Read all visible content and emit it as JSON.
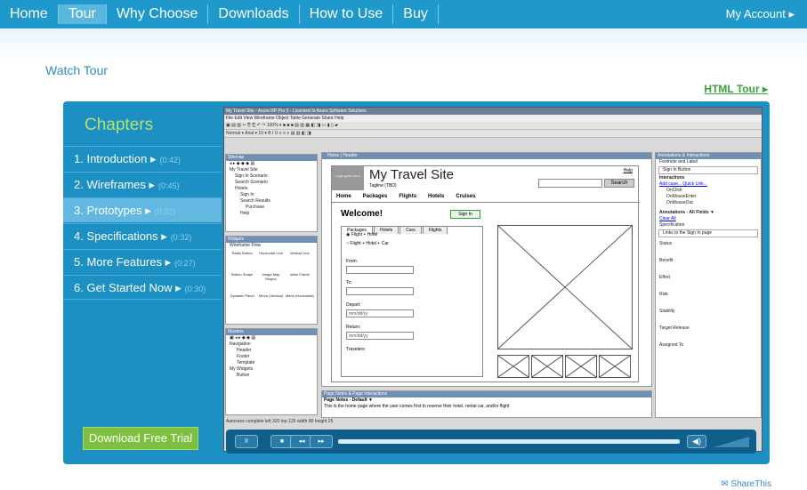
{
  "nav": {
    "items": [
      "Home",
      "Tour",
      "Why Choose",
      "Downloads",
      "How to Use",
      "Buy"
    ],
    "active": "Tour",
    "account": "My Account ▸"
  },
  "watch_tour": "Watch Tour",
  "html_tour": "HTML Tour ▸",
  "chapters": {
    "heading": "Chapters",
    "items": [
      {
        "label": "1. Introduction ▸",
        "time": "(0:42)"
      },
      {
        "label": "2. Wireframes ▸",
        "time": "(0:45)"
      },
      {
        "label": "3. Prototypes ▸",
        "time": "(0:32)"
      },
      {
        "label": "4. Specifications ▸",
        "time": "(0:32)"
      },
      {
        "label": "5. More Features ▸",
        "time": "(0:27)"
      },
      {
        "label": "6. Get Started Now ▸",
        "time": "(0:30)"
      }
    ],
    "active_index": 2
  },
  "download": "Download Free Trial",
  "app": {
    "title": "My Travel Site - Axure RP Pro 5 - Licensed to Axure Software Solutions",
    "menu": "File  Edit  View  Wireframe  Object  Table  Generate  Share  Help",
    "sitemap": {
      "header": "Sitemap",
      "items": [
        "My Travel Site",
        "Sign In Scenario",
        "Search Scenario",
        "Hotels",
        "Sign In",
        "Search Results",
        "Purchase",
        "Help"
      ]
    },
    "widgets": {
      "header": "Widgets",
      "tabs": "Wireframe  Flow",
      "items": [
        "Radio Button",
        "Horizontal Line",
        "Vertical Line",
        "Button Shape",
        "Image Map Region",
        "Inline Frame",
        "Dynamic Panel",
        "Menu (Vertical)",
        "Menu (Horizontal)"
      ]
    },
    "masters": {
      "header": "Masters",
      "items": [
        "Navigation",
        "Header",
        "Footer",
        "Template",
        "My Widgets",
        "Button"
      ]
    },
    "tabs": "Home  |  Header",
    "site": {
      "logo": "Logo goes here",
      "name": "My Travel Site",
      "tagline": "Tagline (TBD)",
      "search": "Search",
      "nav": [
        "Home",
        "Packages",
        "Flights",
        "Hotels",
        "Cruises"
      ],
      "help": "Help",
      "welcome": "Welcome!",
      "signin": "Sign In",
      "form_tabs": [
        "Packages",
        "Hotels",
        "Cars",
        "Flights"
      ],
      "radio1": "Flight + Hotel",
      "radio2": "Flight + Hotel + Car",
      "from": "From:",
      "to": "To:",
      "depart": "Depart:",
      "return": "Return:",
      "date": "mm/dd/yy",
      "travelers": "Travelers:"
    },
    "annotations": {
      "header": "Annotations & Interactions",
      "footnote": "Footnote and Label",
      "label": "Sign In Button",
      "interactions": "Interactions",
      "add": "Add case...  Quick Link...",
      "events": [
        "OnClick",
        "OnMouseEnter",
        "OnMouseOut"
      ],
      "fields": "Annotations - All Fields ▼",
      "clear": "Clear All",
      "spec": "Specification",
      "spec_val": "Links to the Sign In page",
      "list": [
        "Status",
        "Benefit",
        "Effort",
        "Risk",
        "Stability",
        "Target Release",
        "Assigned To"
      ]
    },
    "notes": {
      "header": "Page Notes & Page Interactions",
      "sub": "Page Notes - Default ▼",
      "text": "This is the home page where the user comes first to reserve their hotel, rental car, and/or flight"
    },
    "status": "Autosave complete          left 320  top 125  width 80  height 25"
  },
  "controls": {
    "pause": "II",
    "stop": "■",
    "rew": "◂◂",
    "fwd": "▸▸",
    "volume": "◀)"
  },
  "share": "✉ ShareThis"
}
